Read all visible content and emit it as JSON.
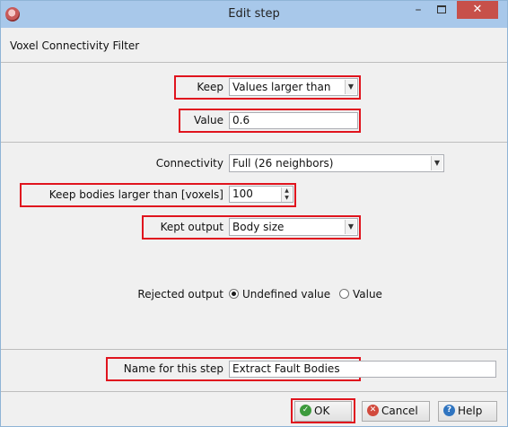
{
  "window": {
    "title": "Edit step",
    "minimize": "–",
    "close": "✕"
  },
  "heading": "Voxel Connectivity Filter",
  "keep": {
    "label": "Keep",
    "value": "Values larger than"
  },
  "value": {
    "label": "Value",
    "value": "0.6"
  },
  "connectivity": {
    "label": "Connectivity",
    "value": "Full (26 neighbors)"
  },
  "bodies": {
    "label": "Keep bodies larger than [voxels]",
    "value": "100"
  },
  "kept_output": {
    "label": "Kept output",
    "value": "Body size"
  },
  "rejected_output": {
    "label": "Rejected output",
    "options": [
      "Undefined value",
      "Value"
    ],
    "selected": "Undefined value"
  },
  "step_name": {
    "label": "Name for this step",
    "value": "Extract Fault Bodies"
  },
  "buttons": {
    "ok": "OK",
    "cancel": "Cancel",
    "help": "Help"
  },
  "icons": {
    "ok": "check-circle-icon",
    "cancel": "x-circle-icon",
    "help": "question-circle-icon",
    "dropdown": "chevron-down-icon",
    "spinner": "spinner-arrows-icon"
  },
  "colors": {
    "highlight": "#e0141e",
    "titlebar": "#a8c8ea",
    "close_button": "#c7504a"
  }
}
